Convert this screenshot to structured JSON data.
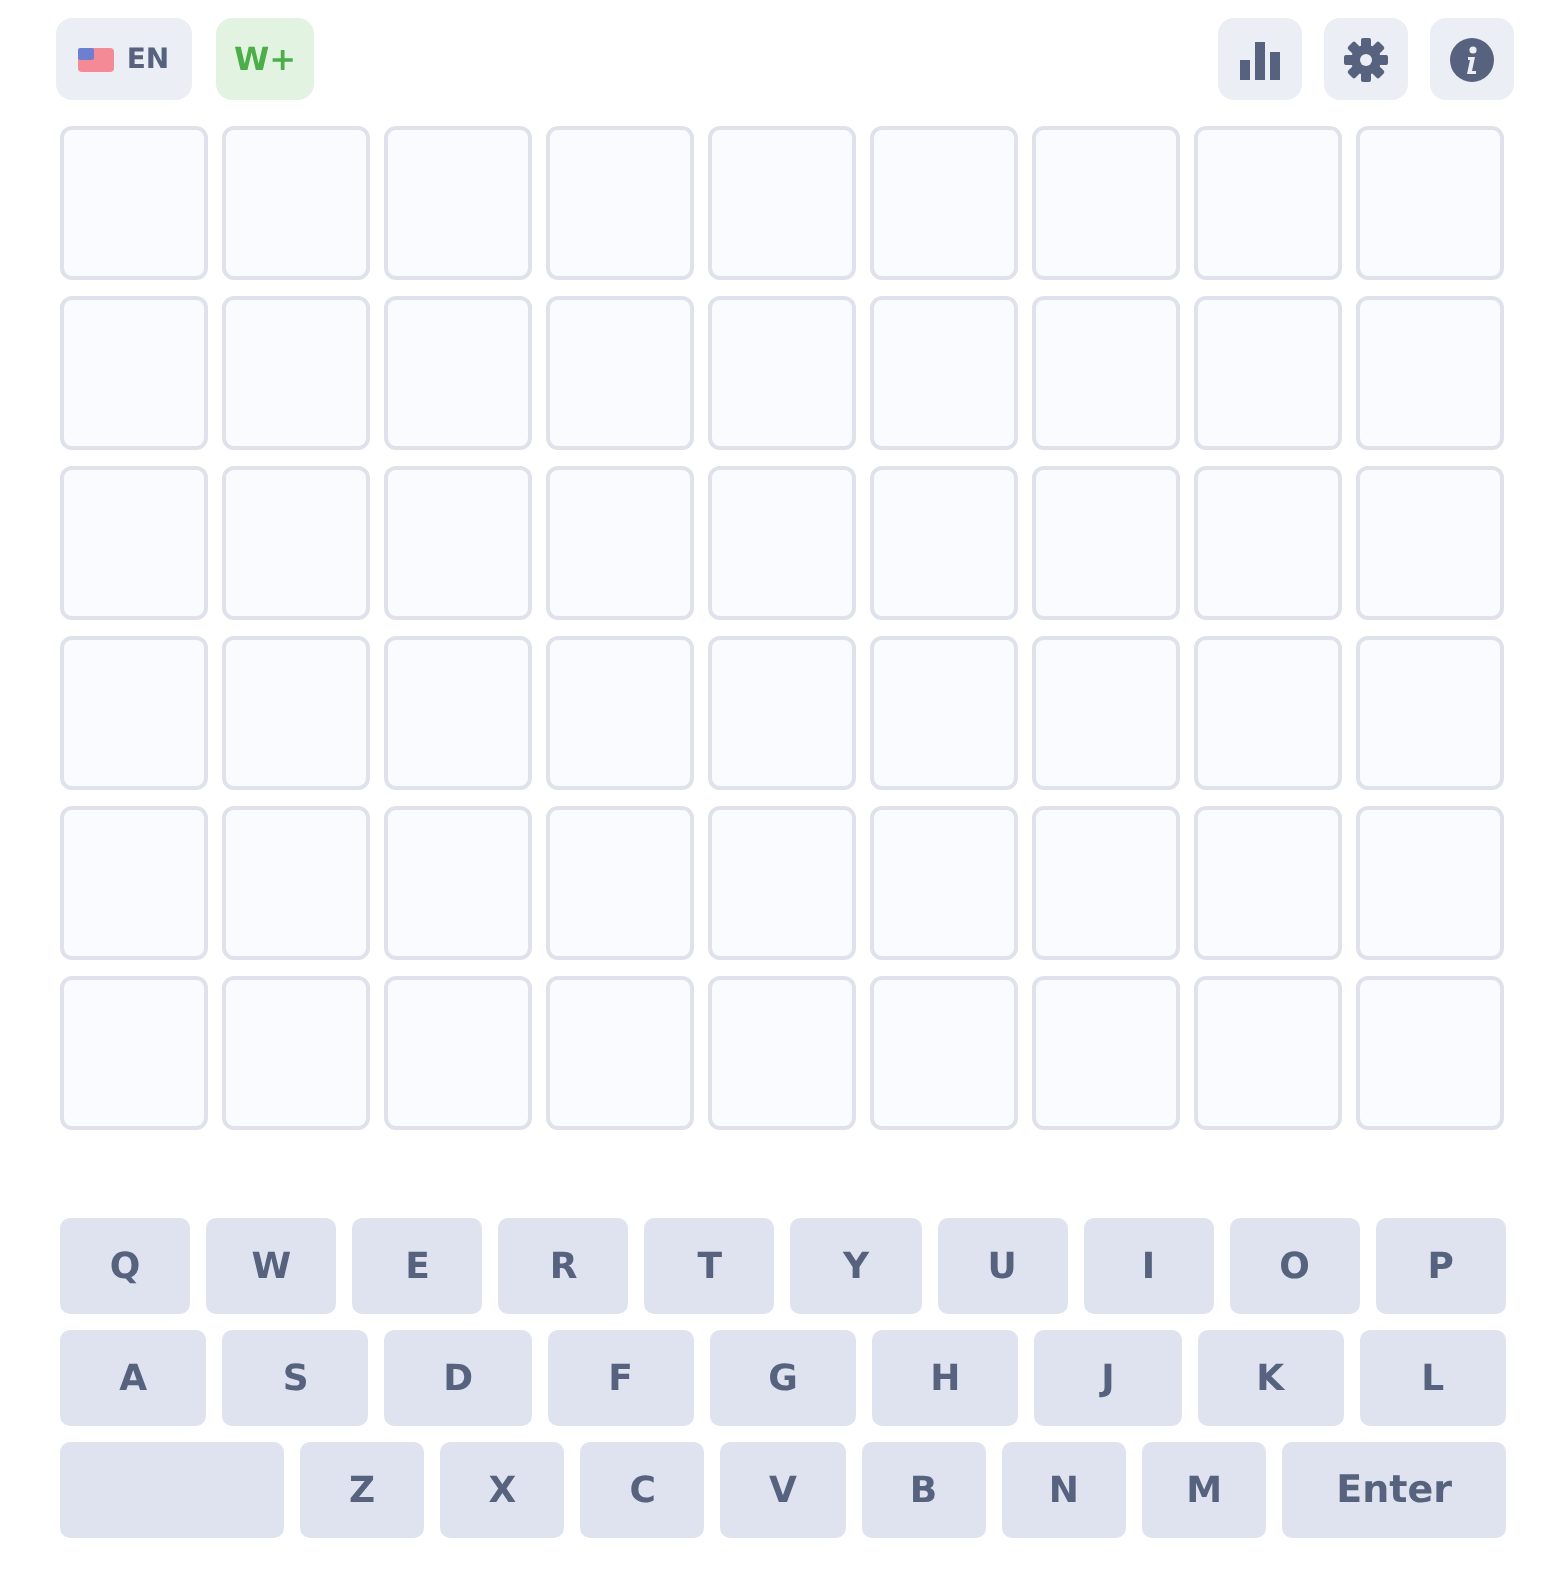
{
  "header": {
    "language": {
      "label": "EN"
    },
    "plus": {
      "label": "W+"
    }
  },
  "grid": {
    "rows": [
      {
        "cells": [
          {
            "filled": false
          },
          {
            "filled": false
          },
          {
            "filled": false
          },
          {
            "filled": false
          },
          {
            "filled": false
          },
          {
            "filled": false
          },
          {
            "filled": false
          },
          {
            "filled": false
          },
          {
            "filled": false
          }
        ]
      },
      {
        "cells": [
          {
            "filled": false
          },
          {
            "filled": false
          },
          {
            "filled": false
          },
          {
            "filled": false
          },
          {
            "filled": false
          },
          {
            "filled": false
          },
          {
            "filled": false
          },
          {
            "filled": false
          },
          {
            "filled": false
          }
        ]
      },
      {
        "cells": [
          {
            "filled": false
          },
          {
            "filled": false
          },
          {
            "filled": false
          },
          {
            "filled": false
          },
          {
            "filled": false
          },
          {
            "filled": false
          },
          {
            "filled": false
          },
          {
            "filled": false
          },
          {
            "filled": false
          }
        ]
      },
      {
        "cells": [
          {
            "filled": false
          },
          {
            "filled": false
          },
          {
            "filled": false
          },
          {
            "filled": false
          },
          {
            "filled": false
          },
          {
            "filled": false
          },
          {
            "filled": false
          },
          {
            "filled": false
          },
          {
            "filled": false
          }
        ]
      },
      {
        "cells": [
          {
            "filled": false
          },
          {
            "filled": false
          },
          {
            "filled": false
          },
          {
            "filled": false
          },
          {
            "filled": false
          },
          {
            "filled": false
          },
          {
            "filled": false
          },
          {
            "filled": false
          },
          {
            "filled": false
          }
        ]
      },
      {
        "cells": [
          {
            "filled": false
          },
          {
            "filled": false
          },
          {
            "filled": false
          },
          {
            "filled": false
          },
          {
            "filled": false
          },
          {
            "filled": false
          },
          {
            "filled": false
          },
          {
            "filled": false
          },
          {
            "filled": false
          }
        ]
      }
    ]
  },
  "keyboard": {
    "rows": [
      {
        "keys": [
          {
            "kind": "letter",
            "label": "Q"
          },
          {
            "kind": "letter",
            "label": "W"
          },
          {
            "kind": "letter",
            "label": "E"
          },
          {
            "kind": "letter",
            "label": "R"
          },
          {
            "kind": "letter",
            "label": "T"
          },
          {
            "kind": "letter",
            "label": "Y"
          },
          {
            "kind": "letter",
            "label": "U"
          },
          {
            "kind": "letter",
            "label": "I"
          },
          {
            "kind": "letter",
            "label": "O"
          },
          {
            "kind": "letter",
            "label": "P"
          }
        ]
      },
      {
        "keys": [
          {
            "kind": "letter",
            "label": "A"
          },
          {
            "kind": "letter",
            "label": "S"
          },
          {
            "kind": "letter",
            "label": "D"
          },
          {
            "kind": "letter",
            "label": "F"
          },
          {
            "kind": "letter",
            "label": "G"
          },
          {
            "kind": "letter",
            "label": "H"
          },
          {
            "kind": "letter",
            "label": "J"
          },
          {
            "kind": "letter",
            "label": "K"
          },
          {
            "kind": "letter",
            "label": "L"
          }
        ]
      },
      {
        "keys": [
          {
            "kind": "blank"
          },
          {
            "kind": "letter",
            "label": "Z"
          },
          {
            "kind": "letter",
            "label": "X"
          },
          {
            "kind": "letter",
            "label": "C"
          },
          {
            "kind": "letter",
            "label": "V"
          },
          {
            "kind": "letter",
            "label": "B"
          },
          {
            "kind": "letter",
            "label": "N"
          },
          {
            "kind": "letter",
            "label": "M"
          },
          {
            "kind": "wide",
            "label": "Enter"
          }
        ]
      }
    ]
  }
}
